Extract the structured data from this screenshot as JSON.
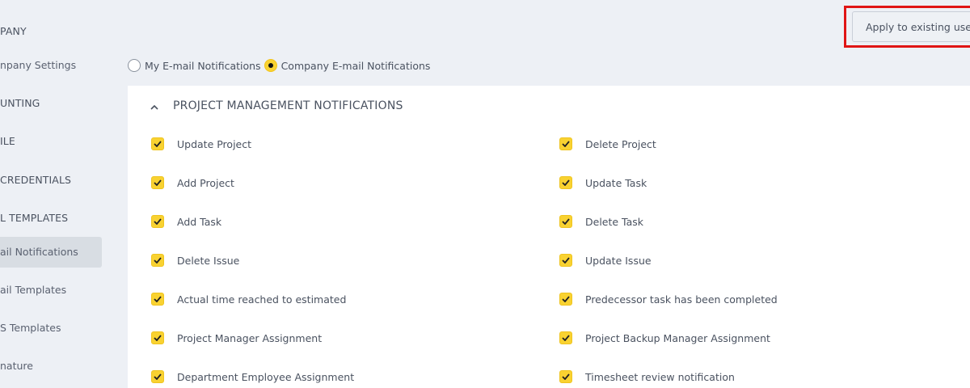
{
  "sidebar": {
    "items": [
      {
        "label": "PANY",
        "type": "section"
      },
      {
        "label": "npany Settings",
        "type": "item"
      },
      {
        "label": "UNTING",
        "type": "section"
      },
      {
        "label": "ILE",
        "type": "section"
      },
      {
        "label": "CREDENTIALS",
        "type": "section"
      },
      {
        "label": "L TEMPLATES",
        "type": "section"
      },
      {
        "label": "ail Notifications",
        "type": "item",
        "active": true
      },
      {
        "label": "ail Templates",
        "type": "item"
      },
      {
        "label": "S Templates",
        "type": "item"
      },
      {
        "label": "nature",
        "type": "item"
      }
    ]
  },
  "header": {
    "apply_label": "Apply to existing users"
  },
  "radios": {
    "mine_label": "My E-mail Notifications",
    "company_label": "Company E-mail Notifications",
    "selected": "company"
  },
  "panel": {
    "title": "PROJECT MANAGEMENT NOTIFICATIONS",
    "left_items": [
      "Update Project",
      "Add Project",
      "Add Task",
      "Delete Issue",
      "Actual time reached to estimated",
      "Project Manager Assignment",
      "Department Employee Assignment"
    ],
    "right_items": [
      "Delete Project",
      "Update Task",
      "Delete Task",
      "Update Issue",
      "Predecessor task has been completed",
      "Project Backup Manager Assignment",
      "Timesheet review notification"
    ]
  },
  "colors": {
    "accent": "#f9d231",
    "highlight": "#e01515",
    "background": "#edf0f5"
  }
}
